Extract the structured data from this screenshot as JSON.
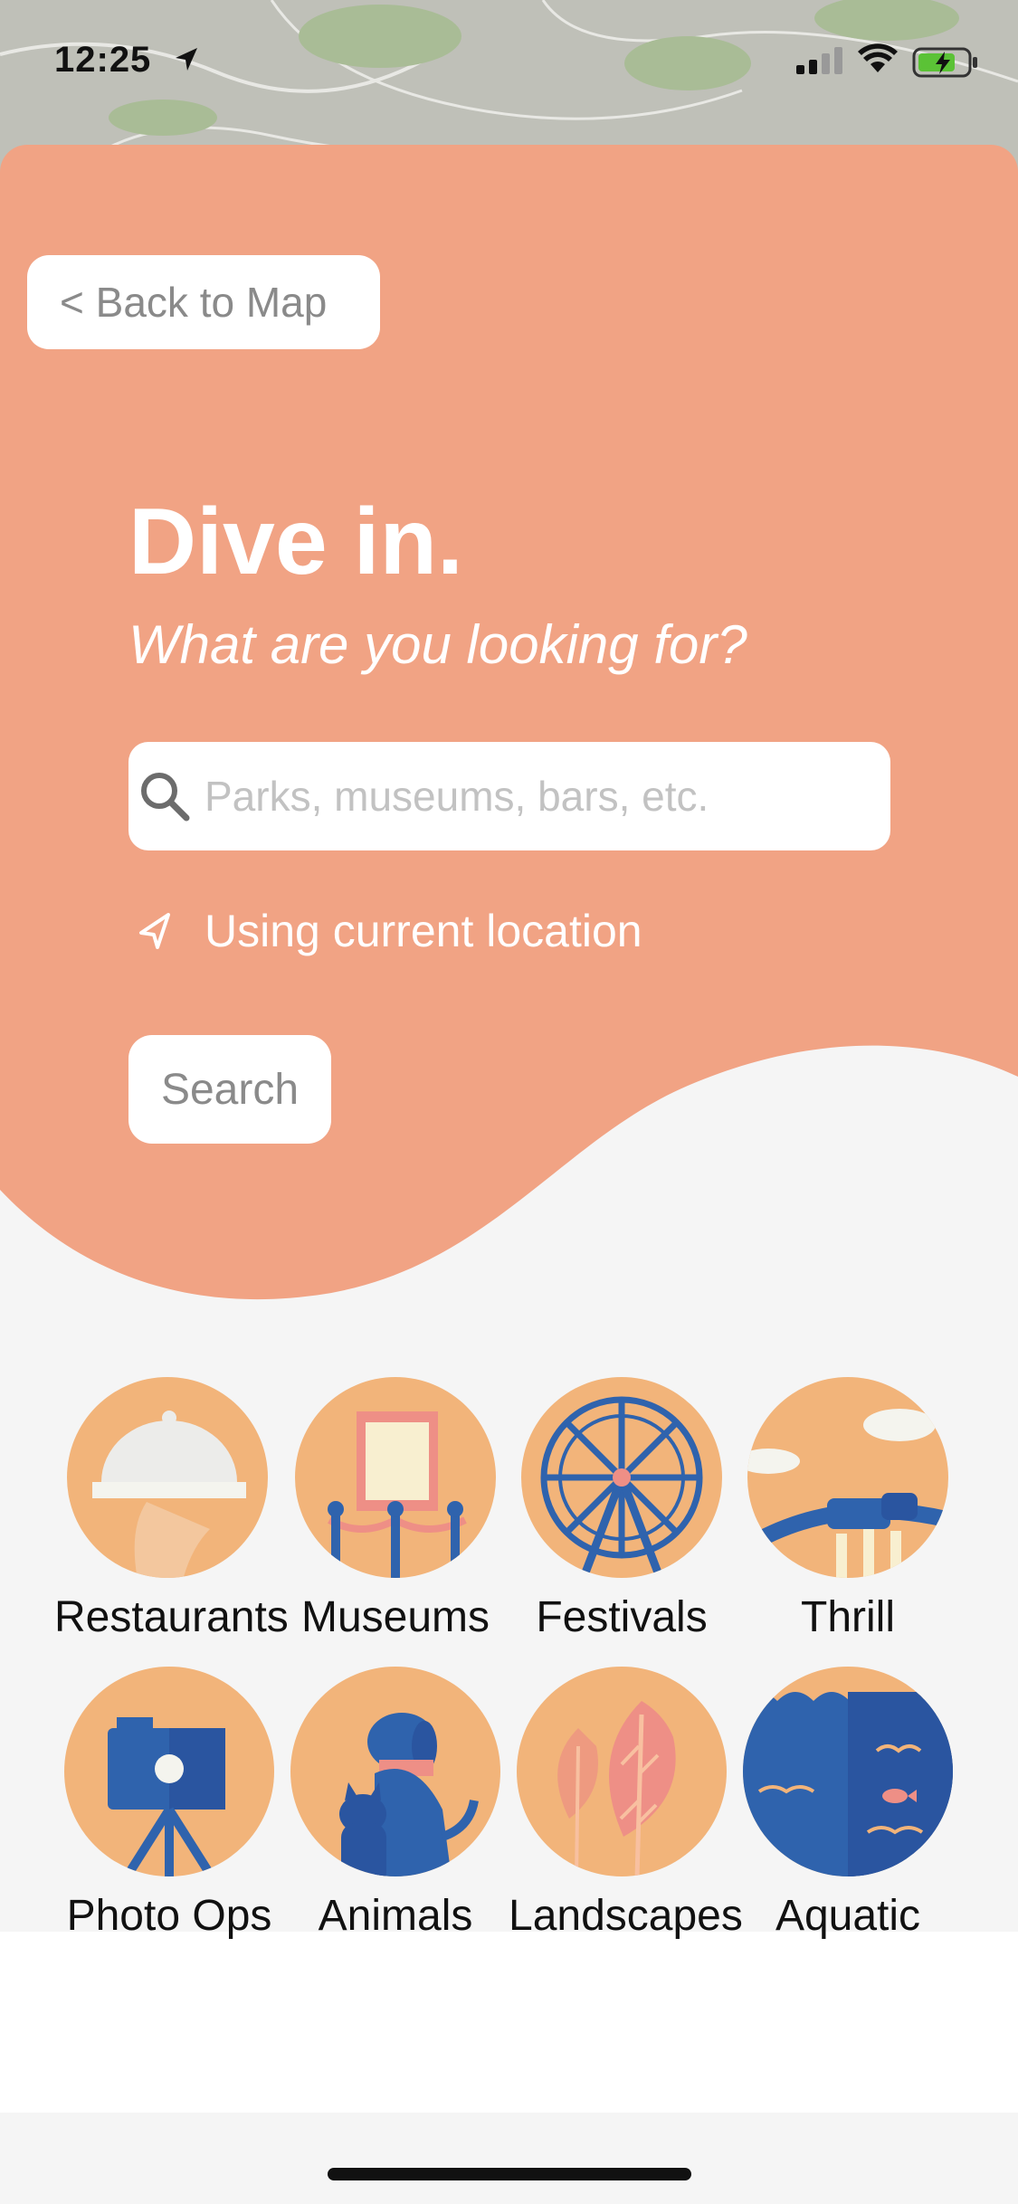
{
  "status_bar": {
    "time": "12:25"
  },
  "nav": {
    "back_label": "< Back to Map"
  },
  "hero": {
    "title": "Dive in.",
    "subtitle": "What are you looking for?"
  },
  "search": {
    "placeholder": "Parks, museums, bars, etc.",
    "value": "",
    "location_text": "Using current location",
    "button_label": "Search"
  },
  "categories": [
    {
      "label": "Restaurants",
      "icon": "restaurant-cloche-icon"
    },
    {
      "label": "Museums",
      "icon": "museum-painting-icon"
    },
    {
      "label": "Festivals",
      "icon": "ferris-wheel-icon"
    },
    {
      "label": "Thrill",
      "icon": "roller-coaster-icon"
    },
    {
      "label": "Photo Ops",
      "icon": "camera-tripod-icon"
    },
    {
      "label": "Animals",
      "icon": "dog-cat-icon"
    },
    {
      "label": "Landscapes",
      "icon": "leaves-icon"
    },
    {
      "label": "Aquatic",
      "icon": "ocean-fish-icon"
    }
  ],
  "colors": {
    "panel": "#f1a384",
    "icon_bg": "#f2b47a",
    "accent_blue": "#2f63ad",
    "background": "#f5f5f5"
  }
}
